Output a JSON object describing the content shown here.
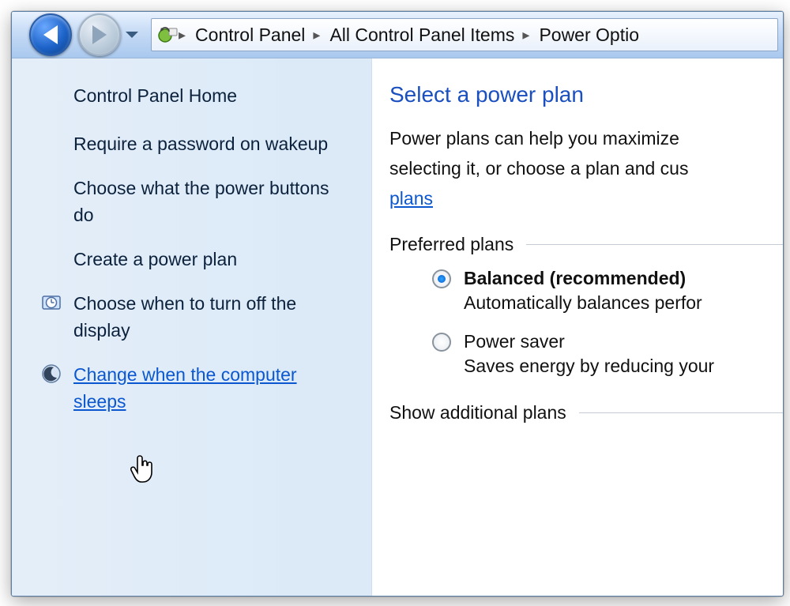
{
  "breadcrumb": {
    "items": [
      "Control Panel",
      "All Control Panel Items",
      "Power Optio"
    ]
  },
  "sidebar": {
    "title": "Control Panel Home",
    "items": [
      {
        "label": "Require a password on wakeup"
      },
      {
        "label": "Choose what the power buttons do"
      },
      {
        "label": "Create a power plan"
      },
      {
        "label": "Choose when to turn off the display"
      },
      {
        "label": "Change when the computer sleeps"
      }
    ]
  },
  "main": {
    "heading": "Select a power plan",
    "desc_line1": "Power plans can help you maximize",
    "desc_line2": "selecting it, or choose a plan and cus",
    "desc_link": "plans",
    "preferred_label": "Preferred plans",
    "plans": [
      {
        "label": "Balanced (recommended)",
        "desc": "Automatically balances perfor"
      },
      {
        "label": "Power saver",
        "desc": "Saves energy by reducing your"
      }
    ],
    "show_more": "Show additional plans"
  }
}
